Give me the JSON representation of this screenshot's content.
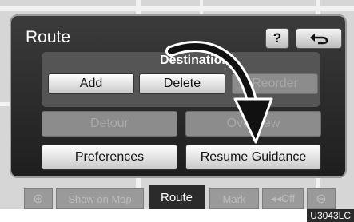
{
  "window": {
    "title": "Route"
  },
  "header": {
    "help_label": "?",
    "back_icon": "return-arrow-icon"
  },
  "destination": {
    "label": "Destination",
    "add_label": "Add",
    "delete_label": "Delete",
    "reorder_label": "Reorder"
  },
  "actions": {
    "detour_label": "Detour",
    "overview_label": "Overview",
    "preferences_label": "Preferences",
    "resume_label": "Resume Guidance"
  },
  "tabs": {
    "circle": "⊕",
    "show_on_map": "Show on Map",
    "route": "Route",
    "mark": "Mark",
    "off": "◂◂Off",
    "minus": "⊖"
  },
  "figure_code": "U3043LC",
  "colors": {
    "panel": "#2a2a2a",
    "button": "#e8e8e8",
    "disabled": "#8c8c8c"
  }
}
